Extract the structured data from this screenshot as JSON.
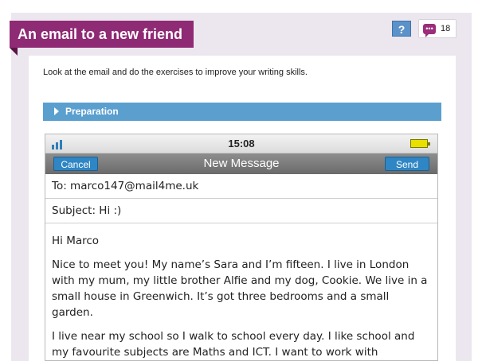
{
  "header": {
    "title": "An email to a new friend",
    "help_label": "?",
    "comment_count": "18"
  },
  "instructions": "Look at the email and do the exercises to improve your writing skills.",
  "preparation": {
    "label": "Preparation"
  },
  "phone": {
    "time": "15:08",
    "cancel_label": "Cancel",
    "title": "New Message",
    "send_label": "Send",
    "to": "To:  marco147@mail4me.uk",
    "subject": "Subject:  Hi :)",
    "greeting": "Hi Marco",
    "paragraphs": [
      "Nice to meet you! My name’s Sara and I’m fifteen. I live in London with my mum, my little brother Alfie and my dog, Cookie. We live in a small house in Greenwich. It’s got three bedrooms and a small garden.",
      "I live near my school so I walk to school every day.  I like school and my favourite subjects are Maths and ICT. I want to work with computers when I"
    ]
  }
}
